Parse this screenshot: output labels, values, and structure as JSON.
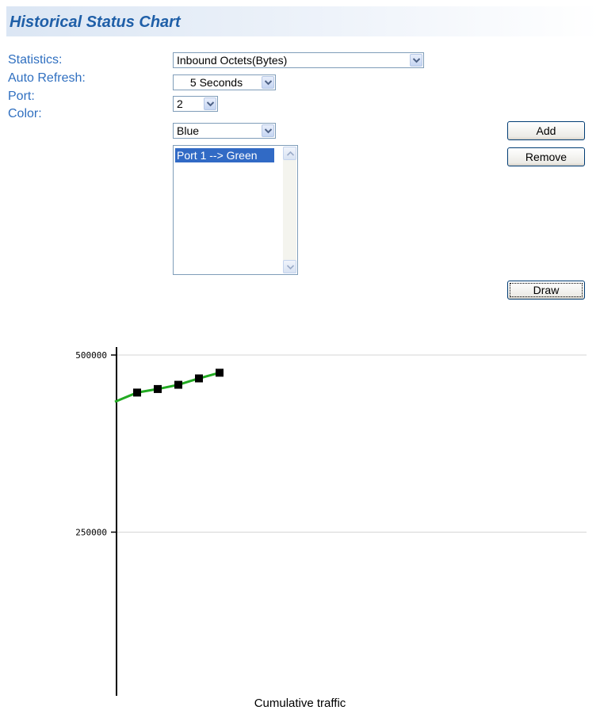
{
  "header": {
    "title": "Historical Status Chart"
  },
  "form": {
    "statistics": {
      "label": "Statistics:",
      "value": "Inbound Octets(Bytes)"
    },
    "auto_refresh": {
      "label": "Auto Refresh:",
      "value": "5 Seconds"
    },
    "port": {
      "label": "Port:",
      "value": "2"
    },
    "color": {
      "label": "Color:",
      "value": "Blue"
    },
    "series_list": {
      "items": [
        "Port 1 --> Green"
      ]
    }
  },
  "buttons": {
    "add": "Add",
    "remove": "Remove",
    "draw": "Draw"
  },
  "icons": {
    "dropdown": "chevron-down-icon",
    "scroll_up": "scroll-up-arrow-icon",
    "scroll_down": "scroll-down-arrow-icon"
  },
  "colors": {
    "title": "#1f5fa8",
    "label": "#2f6fc0",
    "series_line": "#22aa22",
    "marker": "#000000",
    "selection": "#316ac5"
  },
  "chart_data": {
    "type": "line",
    "title": "Cumulative traffic",
    "xlabel": "",
    "ylabel": "",
    "y_ticks": [
      250000,
      500000
    ],
    "y_tick_labels": [
      "250000",
      "500000"
    ],
    "ylim": [
      0,
      500000
    ],
    "grid": true,
    "series": [
      {
        "name": "Port 1 --> Green",
        "color": "#22aa22",
        "x": [
          0,
          1,
          2,
          3,
          4,
          5
        ],
        "y": [
          434000,
          447000,
          452000,
          458000,
          467000,
          475000
        ],
        "markers": [
          false,
          true,
          true,
          true,
          true,
          true
        ]
      }
    ]
  }
}
